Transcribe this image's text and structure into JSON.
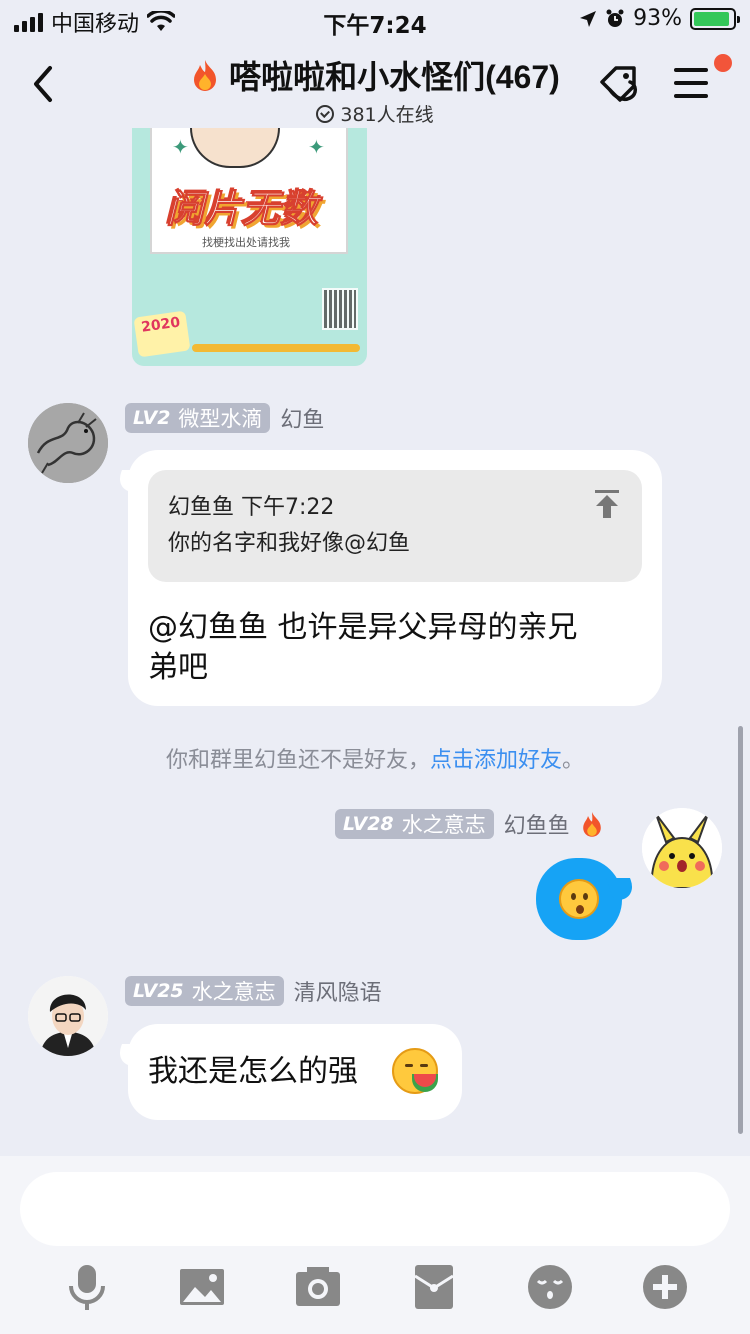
{
  "status_bar": {
    "carrier": "中国移动",
    "time": "下午7:24",
    "battery_percent": "93%",
    "battery_level": 0.93
  },
  "nav": {
    "title": "嗒啦啦和小水怪们(467)",
    "title_icon": "fire-icon",
    "online_text": "381人在线"
  },
  "poster": {
    "headline": "阅片无数",
    "caption": "找梗找出处请找我",
    "badge": "2020"
  },
  "messages": [
    {
      "sender": "幻鱼",
      "level": "LV2",
      "level_title": "微型水滴",
      "quote": {
        "author_time": "幻鱼鱼 下午7:22",
        "text": "你的名字和我好像@幻鱼"
      },
      "text_line1": "@幻鱼鱼 也许是异父异母的亲兄",
      "text_line2": "弟吧"
    },
    {
      "sender": "幻鱼鱼",
      "level": "LV28",
      "level_title": "水之意志",
      "content_icon": "hushed-face-emoji"
    },
    {
      "sender": "清风隐语",
      "level": "LV25",
      "level_title": "水之意志",
      "text": "我还是怎么的强",
      "emoji": "watermelon-face-emoji"
    }
  ],
  "system_message": {
    "prefix": "你和群里幻鱼还不是好友，",
    "link": "点击添加好友",
    "suffix": "。"
  },
  "composer": {
    "placeholder": "",
    "tools": [
      "microphone-icon",
      "image-icon",
      "camera-icon",
      "red-packet-icon",
      "emoji-icon",
      "plus-icon"
    ]
  },
  "colors": {
    "background": "#ebedf5",
    "accent_blue": "#16a3f5",
    "link_blue": "#3b8ff0",
    "level_badge": "#b6bac8",
    "notification_dot": "#f2553a"
  }
}
